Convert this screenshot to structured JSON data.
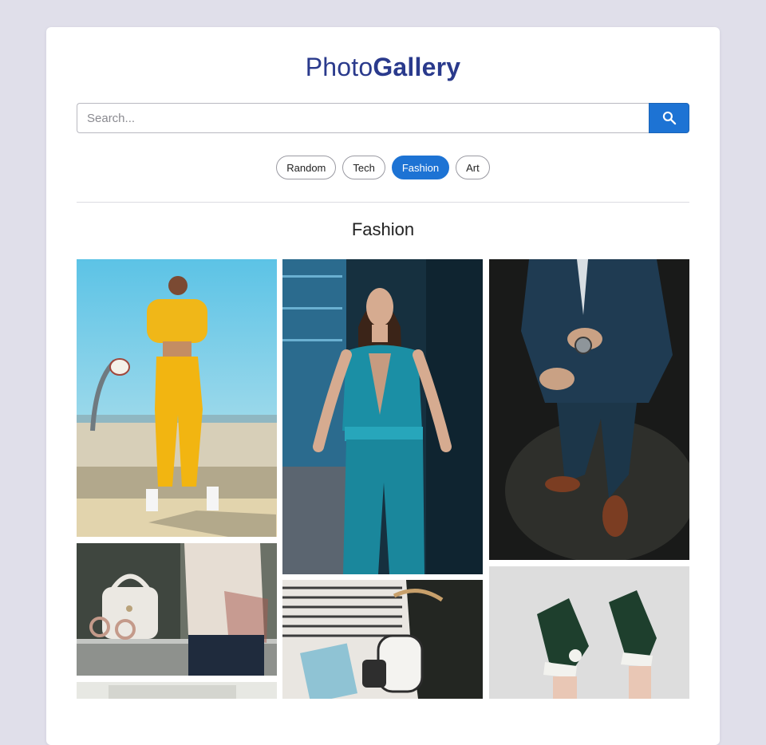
{
  "header": {
    "title_light": "Photo",
    "title_bold": "Gallery"
  },
  "search": {
    "placeholder": "Search...",
    "value": "",
    "button_icon": "search-icon"
  },
  "categories": [
    {
      "label": "Random",
      "active": false
    },
    {
      "label": "Tech",
      "active": false
    },
    {
      "label": "Fashion",
      "active": true
    },
    {
      "label": "Art",
      "active": false
    }
  ],
  "section": {
    "title": "Fashion"
  },
  "colors": {
    "accent": "#1d73d4",
    "title": "#2a3a8c",
    "background": "#e0dfea"
  },
  "photos": [
    {
      "subject": "woman in yellow tracksuit by basketball hoop"
    },
    {
      "subject": "woman in teal jumpsuit"
    },
    {
      "subject": "man in suit adjusting wristwatch"
    },
    {
      "subject": "white handbag and sunglasses on ledge"
    },
    {
      "subject": "flat lay of clothes, sneakers and notebook"
    },
    {
      "subject": "legs wearing black high-top sneakers"
    },
    {
      "subject": "bright interior photo"
    }
  ]
}
